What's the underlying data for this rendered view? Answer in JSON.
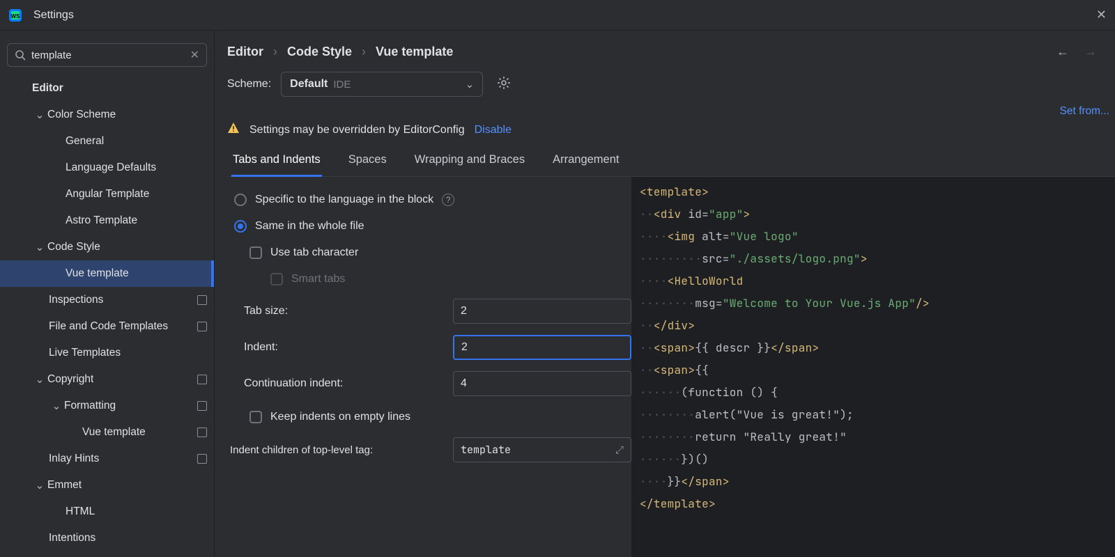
{
  "title": "Settings",
  "search_value": "template",
  "tree": {
    "editor": "Editor",
    "color_scheme": "Color Scheme",
    "cs_general": "General",
    "cs_lang_defaults": "Language Defaults",
    "cs_angular": "Angular Template",
    "cs_astro": "Astro Template",
    "code_style": "Code Style",
    "vue_template": "Vue template",
    "inspections": "Inspections",
    "file_code_templates": "File and Code Templates",
    "live_templates": "Live Templates",
    "copyright": "Copyright",
    "formatting": "Formatting",
    "formatting_vue": "Vue template",
    "inlay_hints": "Inlay Hints",
    "emmet": "Emmet",
    "emmet_html": "HTML",
    "intentions": "Intentions"
  },
  "breadcrumb": {
    "a": "Editor",
    "b": "Code Style",
    "c": "Vue template"
  },
  "scheme": {
    "label": "Scheme:",
    "value": "Default",
    "ide": "IDE"
  },
  "set_from": "Set from...",
  "warning": {
    "text": "Settings may be overridden by EditorConfig",
    "disable": "Disable"
  },
  "tabs": {
    "t1": "Tabs and Indents",
    "t2": "Spaces",
    "t3": "Wrapping and Braces",
    "t4": "Arrangement"
  },
  "form": {
    "radio_specific": "Specific to the language in the block",
    "radio_whole": "Same in the whole file",
    "use_tab": "Use tab character",
    "smart_tabs": "Smart tabs",
    "tab_size_lbl": "Tab size:",
    "tab_size_val": "2",
    "indent_lbl": "Indent:",
    "indent_val": "2",
    "cont_lbl": "Continuation indent:",
    "cont_val": "4",
    "keep_empty": "Keep indents on empty lines",
    "top_level_lbl": "Indent children of top-level tag:",
    "top_level_val": "template"
  }
}
